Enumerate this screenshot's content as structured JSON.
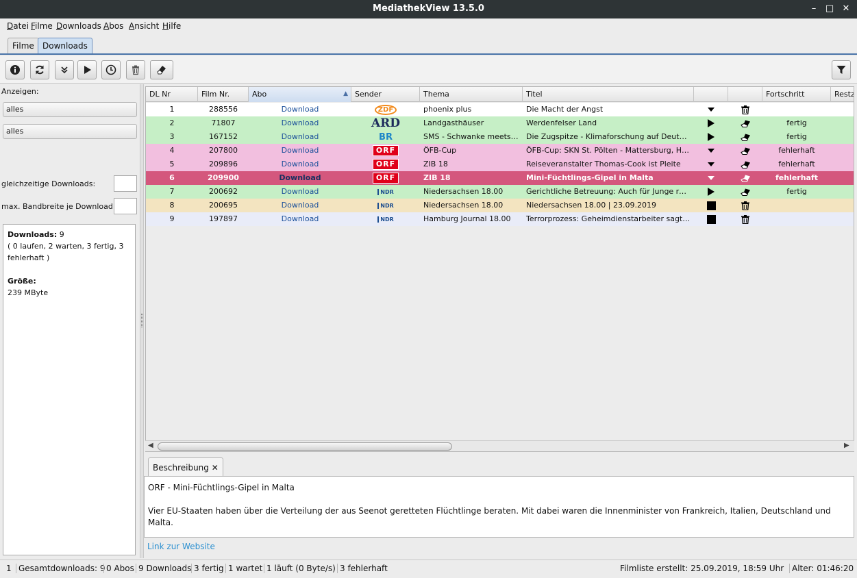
{
  "window": {
    "title": "MediathekView 13.5.0"
  },
  "menu": [
    {
      "label": "Datei",
      "key": "D",
      "rest": "atei"
    },
    {
      "label": "Filme",
      "key": "F",
      "rest": "ilme"
    },
    {
      "label": "Downloads",
      "key": "D",
      "rest": "ownloads"
    },
    {
      "label": "Abos",
      "key": "A",
      "rest": "bos"
    },
    {
      "label": "Ansicht",
      "key": "A",
      "rest": "nsicht"
    },
    {
      "label": "Hilfe",
      "key": "H",
      "rest": "ilfe"
    }
  ],
  "tabs": [
    {
      "label": "Filme",
      "active": false
    },
    {
      "label": "Downloads",
      "active": true
    }
  ],
  "toolbar": {
    "buttons": [
      "info-icon",
      "refresh-icon",
      "double-chevron-down-icon",
      "play-icon",
      "clock-icon",
      "trash-icon",
      "eraser-icon"
    ],
    "filter": "filter-icon"
  },
  "left": {
    "anzeigen_label": "Anzeigen:",
    "combo1": "alles",
    "combo2": "alles",
    "parallel_label": "gleichzeitige Downloads:",
    "bandwidth_label": "max. Bandbreite je Download:",
    "info": {
      "downloads_label": "Downloads:",
      "downloads_value": "9",
      "downloads_detail": "( 0 laufen, 2 warten, 3 fertig, 3 fehlerhaft )",
      "size_label": "Größe:",
      "size_value": "239 MByte"
    }
  },
  "table": {
    "columns": [
      "DL Nr",
      "Film Nr.",
      "Abo",
      "Sender",
      "Thema",
      "Titel",
      "",
      "",
      "Fortschritt",
      "Restz"
    ],
    "sorted_column": "Abo",
    "rows": [
      {
        "dl": "1",
        "film": "288556",
        "abo": "Download",
        "sender": "ZDF",
        "thema": "phoenix plus",
        "titel": "Die Macht der Angst",
        "action": "dropdown",
        "action2": "trash",
        "fortschritt": "",
        "bg": "#ffffff",
        "selected": false
      },
      {
        "dl": "2",
        "film": "71807",
        "abo": "Download",
        "sender": "ARD",
        "thema": "Landgasthäuser",
        "titel": "Werdenfelser Land",
        "action": "play",
        "action2": "eraser",
        "fortschritt": "fertig",
        "bg": "#c6efc6",
        "selected": false
      },
      {
        "dl": "3",
        "film": "167152",
        "abo": "Download",
        "sender": "BR",
        "thema": "SMS - Schwanke meets Show",
        "titel": "Die Zugspitze - Klimaforschung auf Deutschlands höchstem Berg",
        "action": "play",
        "action2": "eraser",
        "fortschritt": "fertig",
        "bg": "#c6efc6",
        "selected": false
      },
      {
        "dl": "4",
        "film": "207800",
        "abo": "Download",
        "sender": "ORF",
        "thema": "ÖFB-Cup",
        "titel": "ÖFB-Cup: SKN St. Pölten - Mattersburg, Highlights",
        "action": "dropdown",
        "action2": "eraser",
        "fortschritt": "fehlerhaft",
        "bg": "#f2bfdf",
        "selected": false
      },
      {
        "dl": "5",
        "film": "209896",
        "abo": "Download",
        "sender": "ORF",
        "thema": "ZIB 18",
        "titel": "Reiseveranstalter Thomas-Cook ist Pleite",
        "action": "dropdown",
        "action2": "eraser",
        "fortschritt": "fehlerhaft",
        "bg": "#f2bfdf",
        "selected": false
      },
      {
        "dl": "6",
        "film": "209900",
        "abo": "Download",
        "sender": "ORF",
        "thema": "ZIB 18",
        "titel": "Mini-Füchtlings-Gipel in Malta",
        "action": "dropdown",
        "action2": "eraser",
        "fortschritt": "fehlerhaft",
        "bg": "#d4577d",
        "selected": true
      },
      {
        "dl": "7",
        "film": "200692",
        "abo": "Download",
        "sender": "NDR",
        "thema": "Niedersachsen 18.00",
        "titel": "Gerichtliche Betreuung: Auch für Junge relevant",
        "action": "play",
        "action2": "eraser",
        "fortschritt": "fertig",
        "bg": "#c6efc6",
        "selected": false
      },
      {
        "dl": "8",
        "film": "200695",
        "abo": "Download",
        "sender": "NDR",
        "thema": "Niedersachsen 18.00",
        "titel": "Niedersachsen 18.00 | 23.09.2019",
        "action": "stop",
        "action2": "trash",
        "fortschritt": "",
        "bg": "#f3e4c0",
        "selected": false
      },
      {
        "dl": "9",
        "film": "197897",
        "abo": "Download",
        "sender": "NDR",
        "thema": "Hamburg Journal 18.00",
        "titel": "Terrorprozess: Geheimdienstarbeiter sagt aus",
        "action": "stop",
        "action2": "trash",
        "fortschritt": "",
        "bg": "#e9ecf8",
        "selected": false
      }
    ]
  },
  "description": {
    "tab_label": "Beschreibung",
    "line1": "ORF  -  Mini-Füchtlings-Gipel in Malta",
    "line2": "Vier EU-Staaten haben über die Verteilung der aus Seenot geretteten Flüchtlinge beraten. Mit dabei waren die Innenminister von Frankreich, Italien, Deutschland und Malta.",
    "link": "Link zur Website"
  },
  "status": {
    "s0": "1",
    "s1": "Gesamtdownloads: 9",
    "s2": "0 Abos",
    "s3": "9 Downloads",
    "s4": "3 fertig",
    "s5": "1 wartet",
    "s6": "1 läuft (0 Byte/s)",
    "s7": "3 fehlerhaft",
    "filmliste": "Filmliste erstellt: 25.09.2019, 18:59 Uhr",
    "alter": "Alter: 01:46:20"
  }
}
